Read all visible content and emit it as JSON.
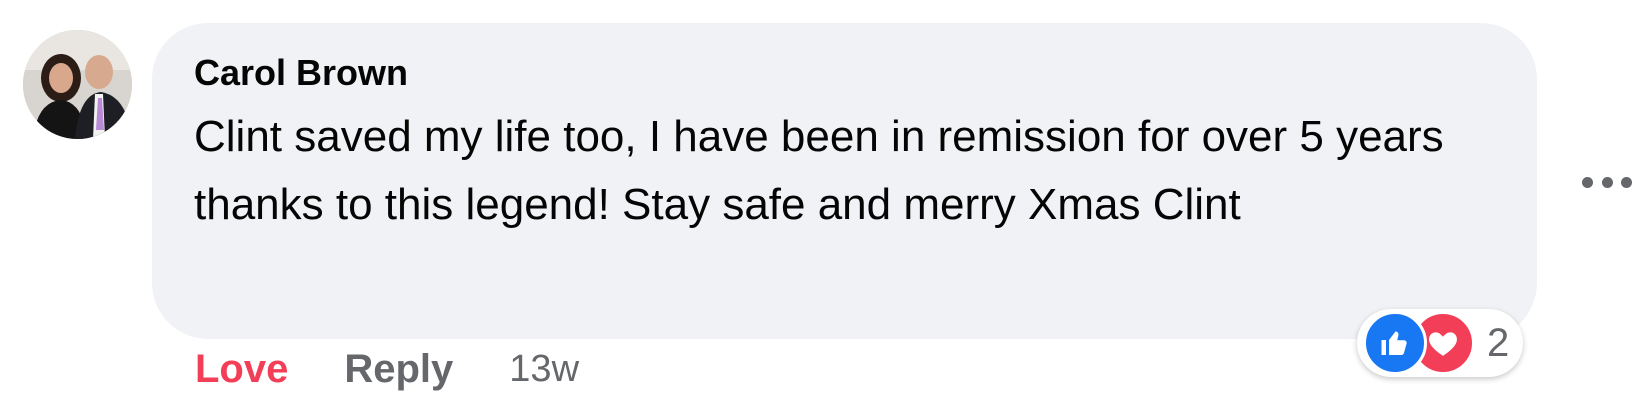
{
  "comment": {
    "author": "Carol Brown",
    "text": "Clint saved my life too, I have been in remission for over 5 years thanks to this legend! Stay safe and merry Xmas Clint",
    "reactions": {
      "icons": [
        "like-icon",
        "love-icon"
      ],
      "count": "2"
    },
    "actions": {
      "love_label": "Love",
      "reply_label": "Reply",
      "timestamp": "13w"
    },
    "colors": {
      "bubble": "#f0f2f5",
      "love": "#f33e58",
      "like": "#1877f2",
      "secondary_text": "#65676b"
    }
  }
}
